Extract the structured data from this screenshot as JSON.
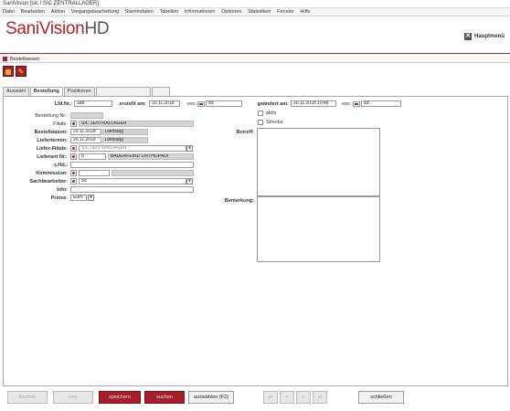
{
  "window": {
    "title": "SaniVision [sic / SIC ZENTRALLAGER]"
  },
  "menu": [
    "Datei",
    "Bearbeiten",
    "Aktion",
    "Vorgangsbearbeitung",
    "Stammdaten",
    "Tabellen",
    "Informationen",
    "Optionen",
    "Statistiken",
    "Fenster",
    "Hilfe"
  ],
  "brand": {
    "name": "SaniVision",
    "suffix": "HD"
  },
  "hauptmenu": "Hauptmenü",
  "subwindow_title": "Bestellwesen",
  "tabs": [
    {
      "label": "Auswahl",
      "active": false,
      "disabled": false
    },
    {
      "label": "Bestellung",
      "active": true,
      "disabled": false
    },
    {
      "label": "Positionen",
      "active": false,
      "disabled": false
    },
    {
      "label": "",
      "active": false,
      "disabled": true
    },
    {
      "label": "",
      "active": false,
      "disabled": true
    }
  ],
  "form": {
    "lfd_label": "Lfd.Nr.:",
    "lfd_value": "188",
    "erstellt_label": "erstellt am:",
    "erstellt_value": "20.11.2018",
    "von_label": "von:",
    "von_value": "sic",
    "geaendert_label": "geändert am:",
    "geaendert_value": "20.11.2018 10:46",
    "von2_label": "von:",
    "von2_value": "sic",
    "bestellung_nr_label": "Bestellung Nr.:",
    "bestellung_nr_value": "",
    "filiale_label": "Filiale:",
    "filiale_value": "SIC ZENTRALLAGER",
    "bestelldatum_label": "Bestelldatum:",
    "bestelldatum_value": "20.11.2018",
    "bestelldatum_day": "Dienstag",
    "liefertermin_label": "Liefertermin:",
    "liefertermin_value": "20.11.2018",
    "liefertermin_day": "Dienstag",
    "lieferfiliale_label": "Liefer-Filiale:",
    "lieferfiliale_value": "SIC ZENTRALLAGER",
    "lieferant_label": "Lieferant Nr.:",
    "lieferant_value": "8",
    "lieferant_name": "BAUERFEIND ORTHOPÄDI",
    "zhd_label": "z.Hd.:",
    "zhd_value": "",
    "kommission_label": "Kommission:",
    "kommission_value": "",
    "sachbearbeiter_label": "Sachbearbeiter:",
    "sachbearbeiter_value": "sic",
    "info_label": "Info:",
    "info_value": "",
    "preise_label": "Preise:",
    "preise_value": "Euro",
    "aktiv_label": "aktiv",
    "strecke_label": "Strecke",
    "betreff_label": "Betreff:",
    "bemerkung_label": "Bemerkung:"
  },
  "footer": {
    "loeschen": "löschen",
    "neu": "neu",
    "speichern": "speichern",
    "suchen": "suchen",
    "auswaehlen": "auswählen (F2)",
    "first": "|<",
    "prev": "<",
    "next": ">",
    "last": ">|",
    "schliessen": "schließen"
  },
  "colors": {
    "accent": "#b0202b"
  }
}
